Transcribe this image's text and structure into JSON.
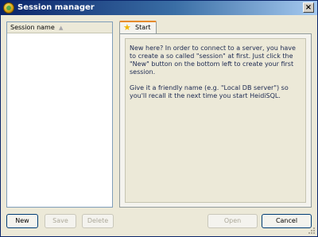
{
  "window": {
    "title": "Session manager",
    "close_glyph": "×"
  },
  "session_list": {
    "column_header": "Session name",
    "sort_glyph": "▲"
  },
  "tabs": [
    {
      "label": "Start",
      "icon": "star-icon"
    }
  ],
  "start_tab": {
    "paragraph1": "New here? In order to connect to a server, you have to create a so called \"session\" at first. Just click the \"New\" button on the bottom left to create your first session.",
    "paragraph2": "Give it a friendly name (e.g. \"Local DB server\") so you'll recall it the next time you start HeidiSQL."
  },
  "buttons": {
    "new": "New",
    "save": "Save",
    "delete": "Delete",
    "open": "Open",
    "cancel": "Cancel"
  },
  "colors": {
    "accent": "#e68b2c",
    "titlebar": "#0a246a"
  }
}
